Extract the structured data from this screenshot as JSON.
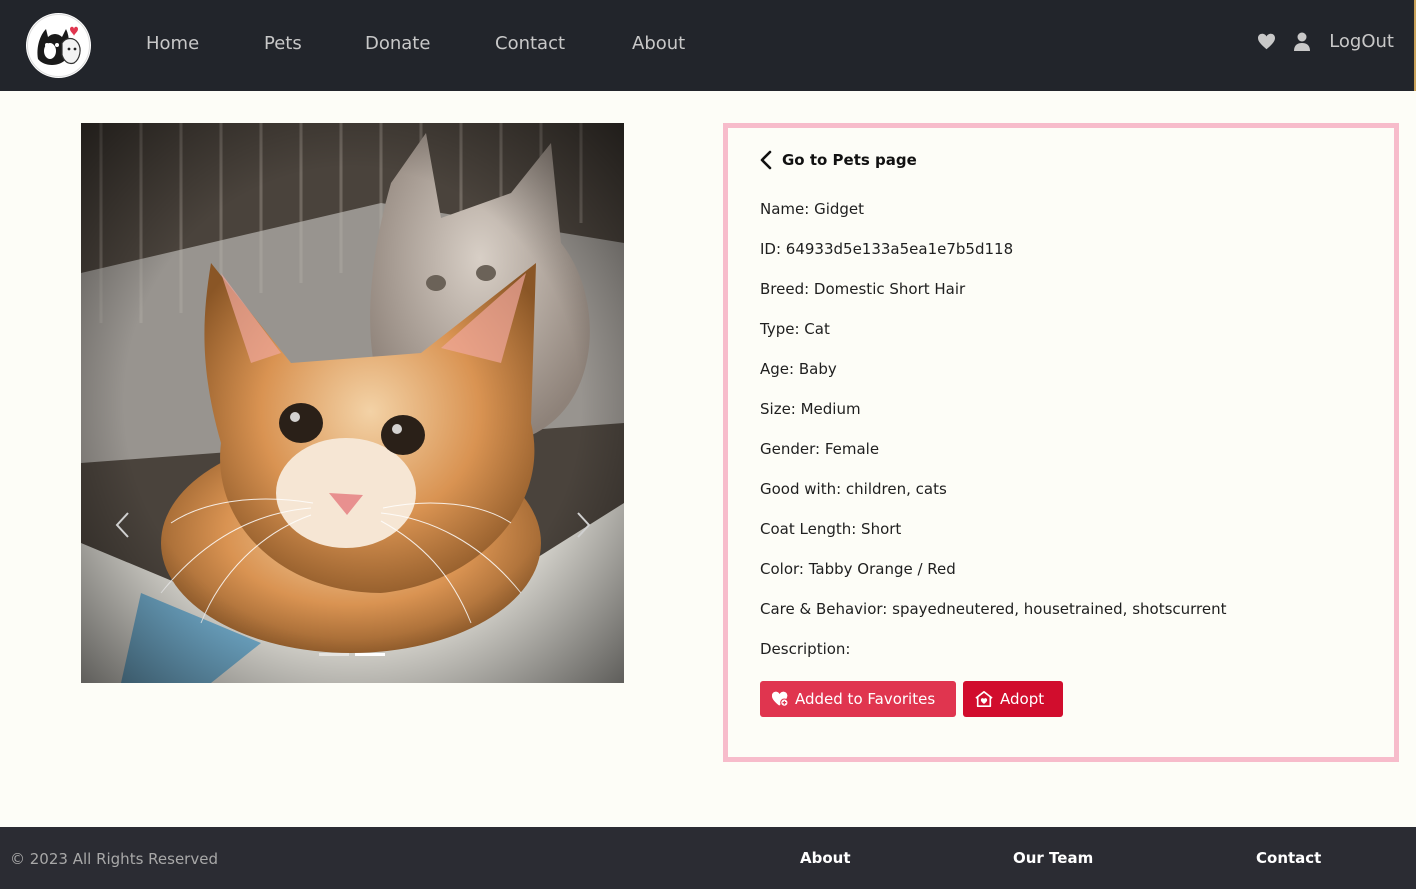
{
  "nav": {
    "links": [
      "Home",
      "Pets",
      "Donate",
      "Contact",
      "About"
    ],
    "logout_label": "LogOut"
  },
  "colors": {
    "navbar_bg": "#22252b",
    "panel_border": "#f7bccb",
    "favorite_button": "#e0354f",
    "adopt_button": "#d10d2d",
    "footer_bg": "#2b2c33",
    "page_bg": "#fdfdf7"
  },
  "carousel": {
    "slide_count": 2,
    "active_slide": 2
  },
  "pet": {
    "back_label": "Go to Pets page",
    "fields": [
      "Name: Gidget",
      "ID: 64933d5e133a5ea1e7b5d118",
      "Breed: Domestic Short Hair",
      "Type: Cat",
      "Age: Baby",
      "Size: Medium",
      "Gender: Female",
      "Good with: children, cats",
      "Coat Length: Short",
      "Color: Tabby Orange / Red",
      "Care & Behavior: spayedneutered, housetrained, shotscurrent",
      "Description:"
    ],
    "favorite_button_label": "Added to Favorites",
    "adopt_button_label": "Adopt"
  },
  "footer": {
    "copyright": "© 2023 All Rights Reserved",
    "links": [
      "About",
      "Our Team",
      "Contact"
    ]
  },
  "icons": {
    "nav": [
      "heart-icon",
      "user-icon"
    ],
    "carousel": [
      "chevron-left-icon",
      "chevron-right-icon"
    ],
    "back": "chevron-left-icon",
    "favorite": "heart-plus-icon",
    "adopt": "home-heart-icon"
  }
}
